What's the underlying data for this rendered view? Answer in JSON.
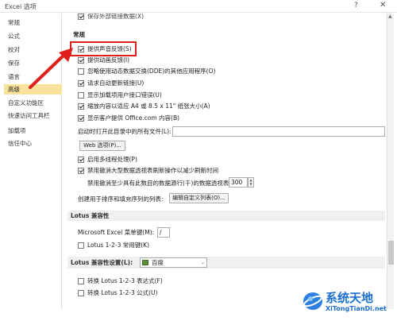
{
  "window": {
    "title": "Excel 选项",
    "help_glyph": "?",
    "close_glyph": "✕"
  },
  "nav": {
    "items": [
      {
        "label": "常规"
      },
      {
        "label": "公式"
      },
      {
        "label": "校对"
      },
      {
        "label": "保存"
      },
      {
        "label": "语言"
      },
      {
        "label": "高级",
        "selected": true
      },
      {
        "label": "自定义功能区"
      },
      {
        "label": "快速访问工具栏"
      },
      {
        "label": "加载项"
      },
      {
        "label": "信任中心"
      }
    ]
  },
  "general": {
    "cut_top_label": "保存外部链接数据(X)",
    "section_title": "常规",
    "opt_sound": "提供声音反馈(S)",
    "opt_animation": "提供动画反馈(I)",
    "opt_dde": "忽略使用动态数据交换(DDE)的其他应用程序(O)",
    "opt_update_links": "请求自动更新链接(U)",
    "opt_addin_errors": "显示加载项用户接口错误(U)",
    "opt_scale_a4": "缩放内容以适应 A4 或 8.5 x 11\" 纸张大小(A)",
    "opt_office_content": "显示客户提供 Office.com 内容(B)",
    "startup_label": "启动时打开此目录中的所有文件(L):",
    "startup_value": "",
    "web_options_button": "Web 选项(P)...",
    "opt_multithread": "启用多线程处理(P)",
    "opt_pivot_undo": "禁用撤消大型数据透视表刷新操作以减少刷新时间",
    "pivot_rows_label": "禁用撤消至少具有此数目的数据源行(千)的数据透视表:",
    "pivot_rows_value": "300",
    "sort_list_label": "创建用于排序和填充序列的列表:",
    "edit_list_button": "编辑自定义列表(O)..."
  },
  "lotus": {
    "section_title": "Lotus 兼容性",
    "menu_key_label": "Microsoft Excel 菜单键(M):",
    "menu_key_value": "/",
    "opt_nav_keys": "Lotus 1-2-3 常用键(K)"
  },
  "lotus_settings": {
    "section_title": "Lotus 兼容性设置(L):",
    "sheet_value": "百度",
    "opt_formula_eval": "转换 Lotus 1-2-3 表达式(F)",
    "opt_formula_entry": "转换 Lotus 1-2-3 公式(U)"
  },
  "watermark": {
    "title": "系统天地",
    "url": "XiTongTianDi.net"
  },
  "colors": {
    "selected_nav": "#f9e39a",
    "highlight": "#e0201b",
    "watermark_blue": "#1a6fd0"
  }
}
